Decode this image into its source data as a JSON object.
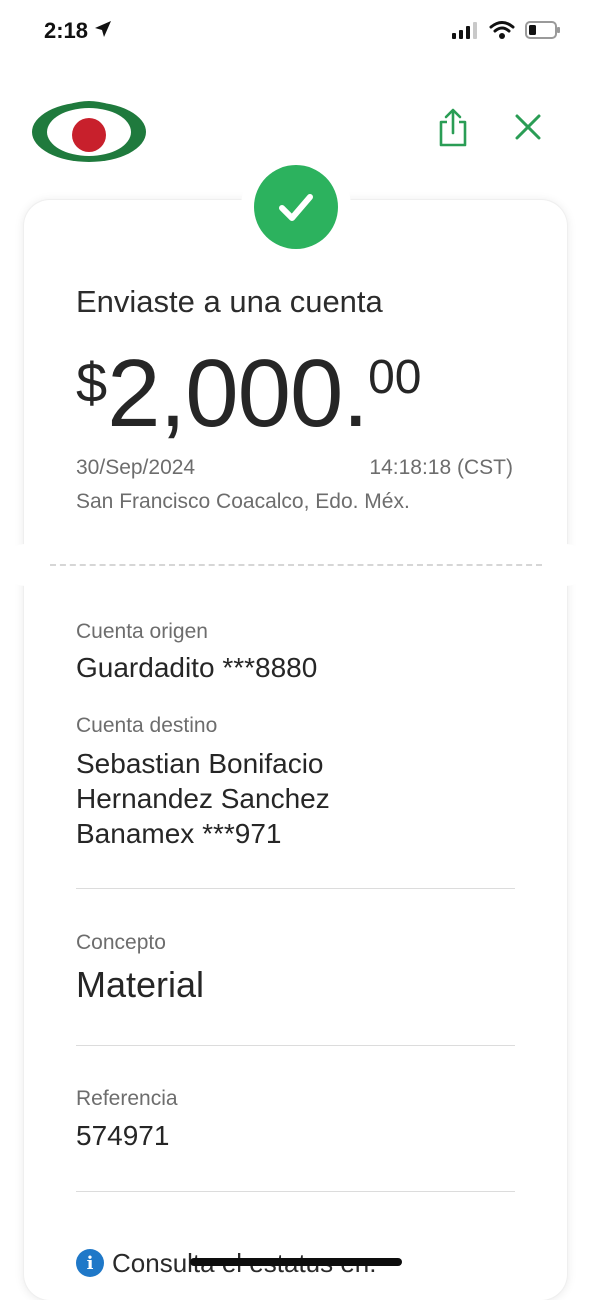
{
  "status_bar": {
    "time": "2:18",
    "location_icon": "location-arrow-icon",
    "signal_icon": "cellular-signal-icon",
    "wifi_icon": "wifi-icon",
    "battery_icon": "battery-icon"
  },
  "header": {
    "logo_icon": "bank-logo-icon",
    "share_icon": "share-icon",
    "close_icon": "close-icon",
    "accent_color": "#2a9d55"
  },
  "receipt": {
    "status_icon": "success-check-icon",
    "success_color": "#2cb25e",
    "headline": "Enviaste a una cuenta",
    "amount": {
      "currency": "$",
      "integer": "2,000.",
      "decimals": "00"
    },
    "date": "30/Sep/2024",
    "time": "14:18:18 (CST)",
    "location": "San Francisco Coacalco, Edo. Méx."
  },
  "details": {
    "origin_label": "Cuenta origen",
    "origin_value": "Guardadito ***8880",
    "destination_label": "Cuenta destino",
    "destination_name_line1": "Sebastian Bonifacio",
    "destination_name_line2": "Hernandez Sanchez",
    "destination_account": "Banamex ***971",
    "concept_label": "Concepto",
    "concept_value": "Material",
    "reference_label": "Referencia",
    "reference_value": "574971",
    "info_icon": "info-icon",
    "info_text": "Consulta el estatus en:"
  }
}
